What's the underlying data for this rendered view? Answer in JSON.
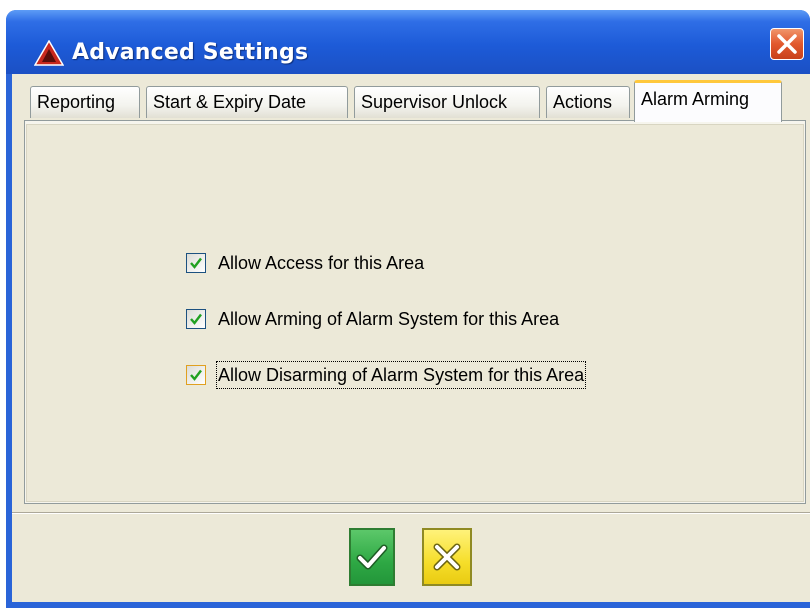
{
  "window": {
    "title": "Advanced Settings",
    "app_icon": "warning-triangle-icon",
    "close_icon": "close-icon"
  },
  "tabs": [
    {
      "label": "Reporting",
      "active": false
    },
    {
      "label": "Start & Expiry Date",
      "active": false
    },
    {
      "label": "Supervisor Unlock",
      "active": false
    },
    {
      "label": "Actions",
      "active": false
    },
    {
      "label": "Alarm Arming",
      "active": true
    }
  ],
  "options": [
    {
      "label": "Allow Access for this Area",
      "checked": true
    },
    {
      "label": "Allow Arming of Alarm System for this Area",
      "checked": true
    },
    {
      "label": "Allow Disarming of Alarm System for this Area",
      "checked": true,
      "focused": true
    }
  ],
  "buttons": {
    "ok_icon": "checkmark-icon",
    "cancel_icon": "x-icon"
  },
  "colors": {
    "titlebar": "#1d5bd8",
    "ok_button": "#2ea844",
    "cancel_button": "#f6de2a",
    "active_tab_accent": "#ffc83c"
  }
}
